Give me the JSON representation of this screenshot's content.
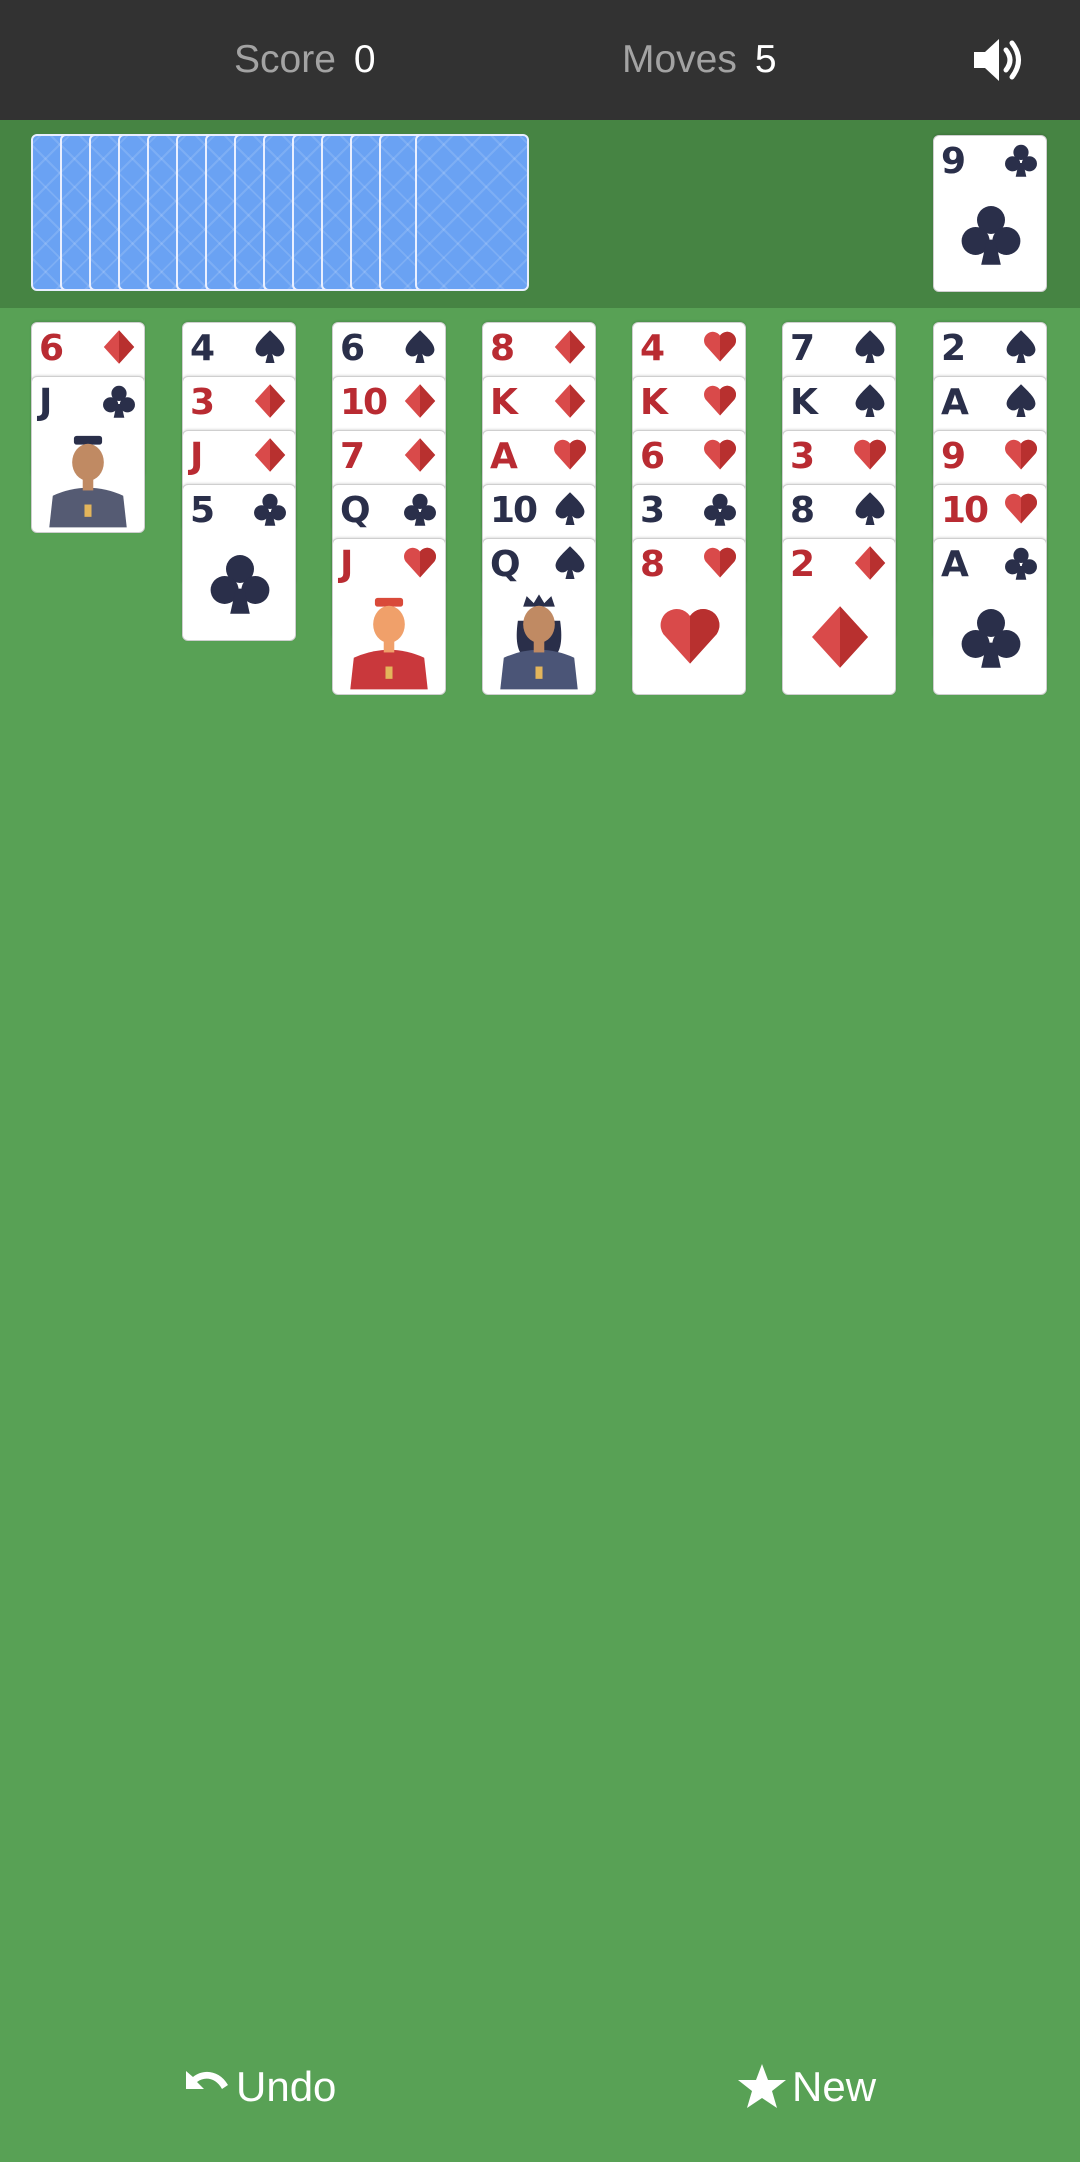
{
  "header": {
    "score_label": "Score",
    "score_value": "0",
    "moves_label": "Moves",
    "moves_value": "5",
    "sound_icon": "speaker-icon"
  },
  "stock": {
    "card_count": 14,
    "back_color": "#6aa2f3"
  },
  "foundation": {
    "top_card": {
      "rank": "9",
      "suit": "clubs"
    }
  },
  "tableau": [
    [
      {
        "rank": "6",
        "suit": "diamonds"
      },
      {
        "rank": "J",
        "suit": "clubs"
      }
    ],
    [
      {
        "rank": "4",
        "suit": "spades"
      },
      {
        "rank": "3",
        "suit": "diamonds"
      },
      {
        "rank": "J",
        "suit": "diamonds"
      },
      {
        "rank": "5",
        "suit": "clubs"
      }
    ],
    [
      {
        "rank": "6",
        "suit": "spades"
      },
      {
        "rank": "10",
        "suit": "diamonds"
      },
      {
        "rank": "7",
        "suit": "diamonds"
      },
      {
        "rank": "Q",
        "suit": "clubs"
      },
      {
        "rank": "J",
        "suit": "hearts"
      }
    ],
    [
      {
        "rank": "8",
        "suit": "diamonds"
      },
      {
        "rank": "K",
        "suit": "diamonds"
      },
      {
        "rank": "A",
        "suit": "hearts"
      },
      {
        "rank": "10",
        "suit": "spades"
      },
      {
        "rank": "Q",
        "suit": "spades"
      }
    ],
    [
      {
        "rank": "4",
        "suit": "hearts"
      },
      {
        "rank": "K",
        "suit": "hearts"
      },
      {
        "rank": "6",
        "suit": "hearts"
      },
      {
        "rank": "3",
        "suit": "clubs"
      },
      {
        "rank": "8",
        "suit": "hearts"
      }
    ],
    [
      {
        "rank": "7",
        "suit": "spades"
      },
      {
        "rank": "K",
        "suit": "spades"
      },
      {
        "rank": "3",
        "suit": "hearts"
      },
      {
        "rank": "8",
        "suit": "spades"
      },
      {
        "rank": "2",
        "suit": "diamonds"
      }
    ],
    [
      {
        "rank": "2",
        "suit": "spades"
      },
      {
        "rank": "A",
        "suit": "spades"
      },
      {
        "rank": "9",
        "suit": "hearts"
      },
      {
        "rank": "10",
        "suit": "hearts"
      },
      {
        "rank": "A",
        "suit": "clubs"
      }
    ]
  ],
  "colors": {
    "felt": "#58a155",
    "stock_bar": "#468443",
    "top_bar": "#323232",
    "red_suit": "#b92b32",
    "black_suit": "#2a2f4a"
  },
  "footer": {
    "undo_label": "Undo",
    "undo_icon": "undo-arrow-icon",
    "new_label": "New",
    "new_icon": "star-icon"
  }
}
